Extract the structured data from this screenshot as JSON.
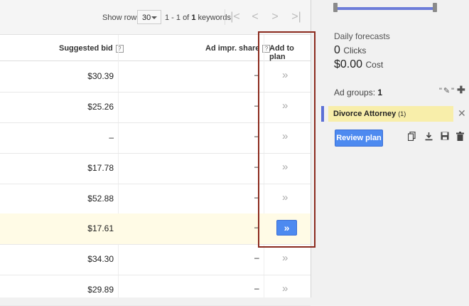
{
  "pager": {
    "show_rows_label": "Show rows:",
    "rows_value": "30",
    "range_prefix": "1 - 1 of",
    "range_count": "1",
    "range_suffix": "keywords",
    "first_icon": "|<",
    "prev_icon": "<",
    "next_icon": ">",
    "last_icon": ">|"
  },
  "table": {
    "headers": {
      "suggested_bid": "Suggested bid",
      "ad_impr_share": "Ad impr. share",
      "add_to_plan": "Add to plan",
      "help_mark": "?"
    },
    "add_glyph": "»",
    "rows": [
      {
        "bid": "$30.39",
        "impr": "–",
        "selected": false
      },
      {
        "bid": "$25.26",
        "impr": "–",
        "selected": false
      },
      {
        "bid": "–",
        "impr": "–",
        "selected": false
      },
      {
        "bid": "$17.78",
        "impr": "–",
        "selected": false
      },
      {
        "bid": "$52.88",
        "impr": "–",
        "selected": false
      },
      {
        "bid": "$17.61",
        "impr": "–",
        "selected": true
      },
      {
        "bid": "$34.30",
        "impr": "–",
        "selected": false
      },
      {
        "bid": "$29.89",
        "impr": "–",
        "selected": false
      }
    ]
  },
  "sidebar": {
    "forecast_title": "Daily forecasts",
    "clicks_value": "0",
    "clicks_unit": "Clicks",
    "cost_value": "$0.00",
    "cost_unit": "Cost",
    "ad_groups_label": "Ad groups:",
    "ad_groups_count": "1",
    "ad_group_tools_icon": "\"✎\"",
    "add_icon": "✚",
    "group_name": "Divorce Attorney",
    "group_count": "(1)",
    "close_icon": "✕",
    "review_button": "Review plan",
    "tool_icons": [
      "copy-icon",
      "download-icon",
      "save-icon",
      "trash-icon"
    ]
  },
  "colors": {
    "accent": "#4d8af0",
    "slider": "#6d7dd9",
    "group_highlight": "#f8eeaa",
    "row_highlight": "#fffbe6",
    "frame": "#8b2a1e"
  }
}
